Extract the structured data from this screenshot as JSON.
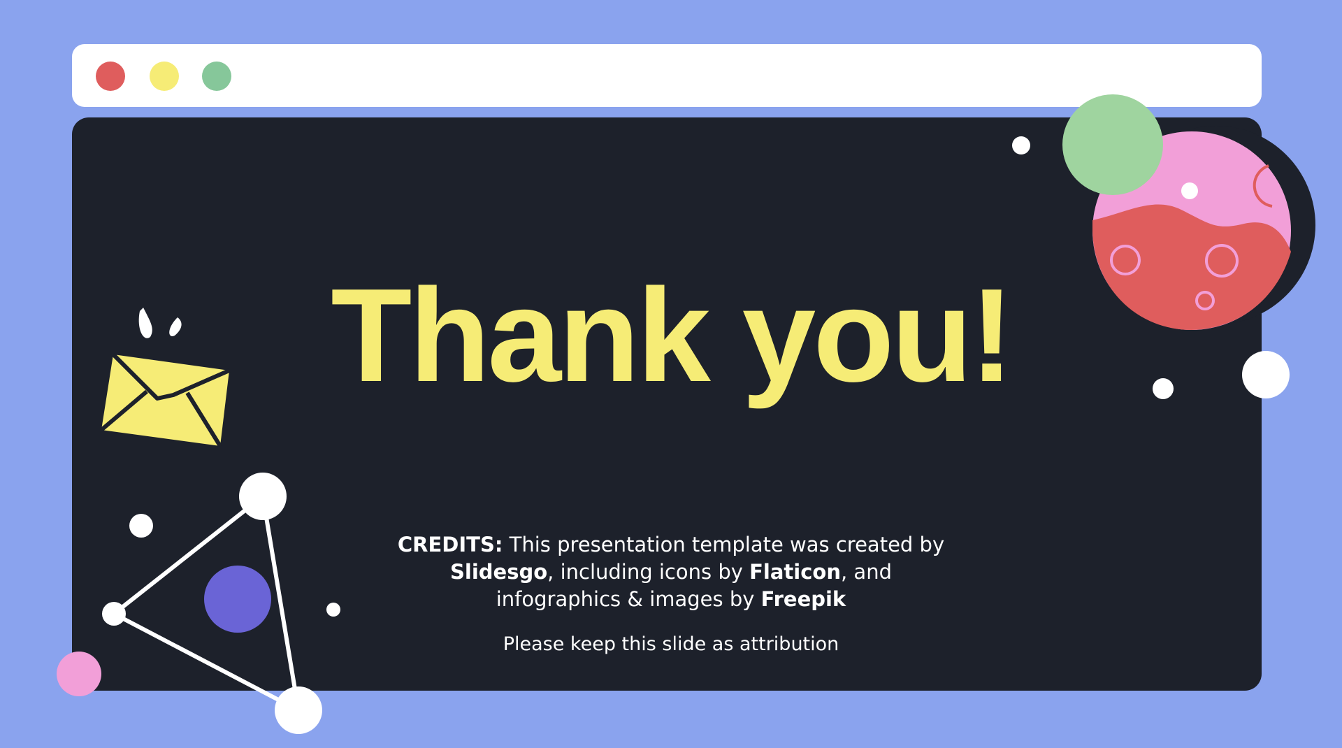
{
  "slide": {
    "title": "Thank you!",
    "credits": {
      "label": "CREDITS:",
      "text1": " This presentation template was created by ",
      "brand1": "Slidesgo",
      "text2": ", including icons by ",
      "brand2": "Flaticon",
      "text3": ", and infographics & images by ",
      "brand3": "Freepik"
    },
    "attribution": "Please keep this slide as attribution"
  },
  "icons": {
    "window_dots": [
      "red-dot-icon",
      "yellow-dot-icon",
      "green-dot-icon"
    ],
    "envelope": "envelope-icon",
    "planet": "planet-icon",
    "network": "network-triangle-icon"
  },
  "colors": {
    "background": "#8aa3ee",
    "slide": "#1d212b",
    "accent_yellow": "#f6ec76",
    "red": "#df5d5d",
    "green": "#86c79a",
    "pink": "#f29fd8",
    "purple": "#6a64d6"
  }
}
